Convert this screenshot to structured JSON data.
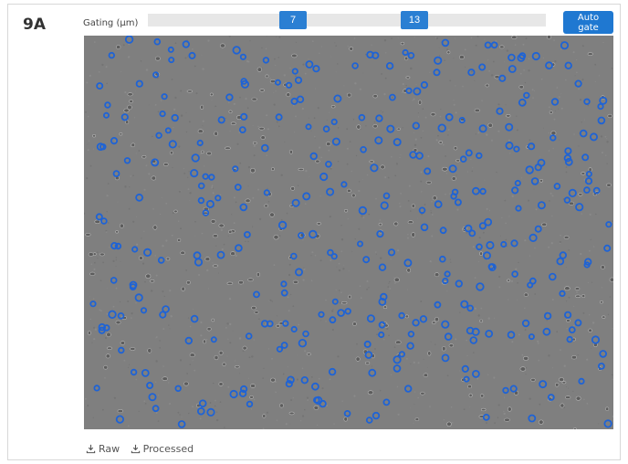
{
  "panel": {
    "id": "9A"
  },
  "gating": {
    "label": "Gating (µm)",
    "min": 7,
    "max": 13
  },
  "button": {
    "auto_gate": "Auto gate"
  },
  "downloads": {
    "raw": "Raw",
    "processed": "Processed"
  },
  "colors": {
    "accent": "#2a7fd3",
    "image_background": "#7f7f7f",
    "marker": "#1e63d6"
  }
}
